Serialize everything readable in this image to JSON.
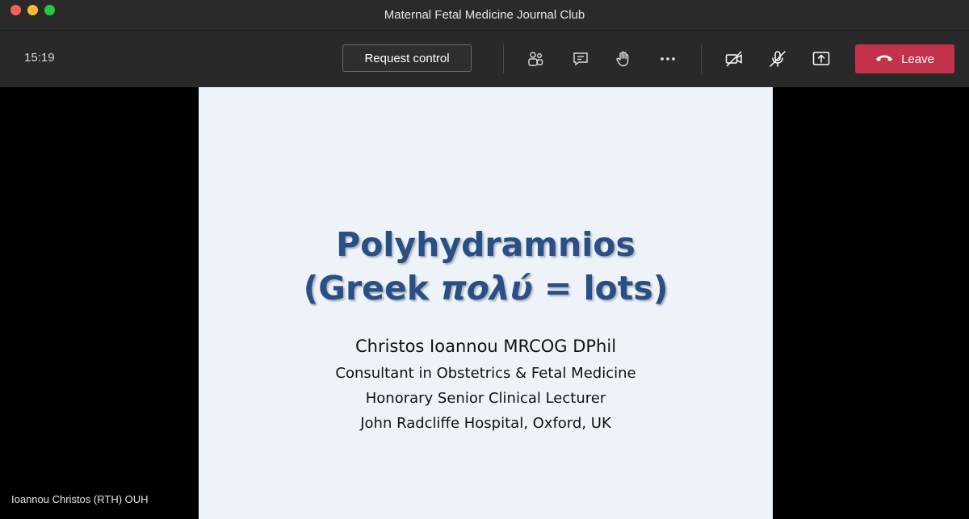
{
  "window": {
    "title": "Maternal Fetal Medicine Journal Club"
  },
  "toolbar": {
    "time": "15:19",
    "request_control_label": "Request control",
    "leave_label": "Leave",
    "icons": [
      "participants-icon",
      "chat-icon",
      "raise-hand-icon",
      "more-options-icon",
      "camera-off-icon",
      "mic-off-icon",
      "share-screen-icon",
      "phone-hangup-icon"
    ],
    "leave_color": "#c4314b"
  },
  "slide": {
    "title_line1": "Polyhydramnios",
    "title_line2_prefix": "(Greek ",
    "title_line2_greek": "πολύ",
    "title_line2_suffix": " = lots)",
    "author": "Christos Ioannou MRCOG DPhil",
    "role1": "Consultant in Obstetrics & Fetal Medicine",
    "role2": "Honorary Senior Clinical Lecturer",
    "affiliation": "John Radcliffe Hospital, Oxford, UK",
    "title_color": "#284f86",
    "background_color": "#edf3f8"
  },
  "presenter": {
    "name": "Ioannou Christos (RTH) OUH"
  }
}
